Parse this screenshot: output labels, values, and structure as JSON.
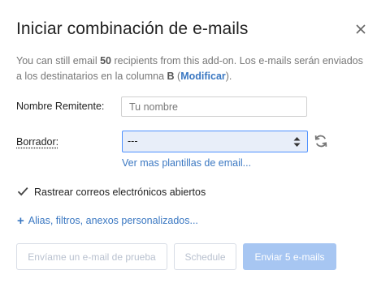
{
  "dialog": {
    "title": "Iniciar combinación de e-mails",
    "close_icon": "close-icon"
  },
  "info": {
    "text_1": "You can still email ",
    "count": "50",
    "text_2": " recipients from this add-on. Los e-mails serán enviados a los destinatarios en la columna ",
    "column": "B",
    "text_3": " (",
    "modify_link": "Modificar",
    "text_4": ")."
  },
  "form": {
    "sender_label": "Nombre Remitente:",
    "sender_placeholder": "Tu nombre",
    "sender_value": "",
    "draft_label": "Borrador:",
    "draft_selected": "---",
    "refresh_icon": "refresh-icon",
    "more_templates_link": "Ver mas plantillas de email..."
  },
  "tracking": {
    "checked": true,
    "label": "Rastrear correos electrónicos abiertos"
  },
  "advanced": {
    "plus": "+",
    "label": "Alias, filtros, anexos personalizados..."
  },
  "buttons": {
    "test_label": "Envíame un e-mail de prueba",
    "schedule_label": "Schedule",
    "send_label": "Enviar 5 e-mails"
  },
  "colors": {
    "link": "#3b78c2",
    "select_bg": "#e8eef9",
    "select_border": "#4d90fe",
    "primary_disabled": "#a7c6f2"
  }
}
